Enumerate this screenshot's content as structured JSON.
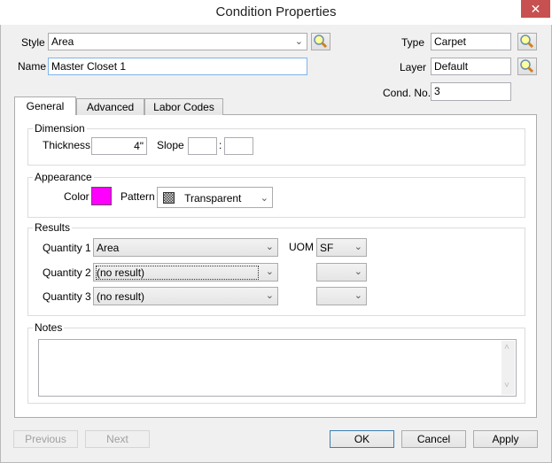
{
  "window": {
    "title": "Condition Properties",
    "close_icon": "close-icon"
  },
  "header": {
    "style_label": "Style",
    "style_value": "Area",
    "name_label": "Name",
    "name_value": "Master Closet 1",
    "type_label": "Type",
    "type_value": "Carpet",
    "layer_label": "Layer",
    "layer_value": "Default",
    "cond_no_label": "Cond. No.",
    "cond_no_value": "3"
  },
  "tabs": [
    {
      "label": "General",
      "active": true
    },
    {
      "label": "Advanced",
      "active": false
    },
    {
      "label": "Labor Codes",
      "active": false
    }
  ],
  "dimension": {
    "legend": "Dimension",
    "thickness_label": "Thickness",
    "thickness_value": "4\"",
    "slope_label": "Slope",
    "slope_rise": "",
    "slope_separator": ":",
    "slope_run": ""
  },
  "appearance": {
    "legend": "Appearance",
    "color_label": "Color",
    "color_value": "#ff00ff",
    "pattern_label": "Pattern",
    "pattern_value": "Transparent"
  },
  "results": {
    "legend": "Results",
    "uom_label": "UOM",
    "rows": [
      {
        "label": "Quantity 1",
        "value": "Area",
        "uom": "SF"
      },
      {
        "label": "Quantity 2",
        "value": "(no result)",
        "uom": ""
      },
      {
        "label": "Quantity 3",
        "value": "(no result)",
        "uom": ""
      }
    ]
  },
  "notes": {
    "legend": "Notes",
    "value": ""
  },
  "footer": {
    "previous": "Previous",
    "next": "Next",
    "ok": "OK",
    "cancel": "Cancel",
    "apply": "Apply"
  },
  "colors": {
    "close": "#c75050",
    "default_button_border": "#3c7fb1",
    "name_focus_border": "#7eb4ea"
  }
}
